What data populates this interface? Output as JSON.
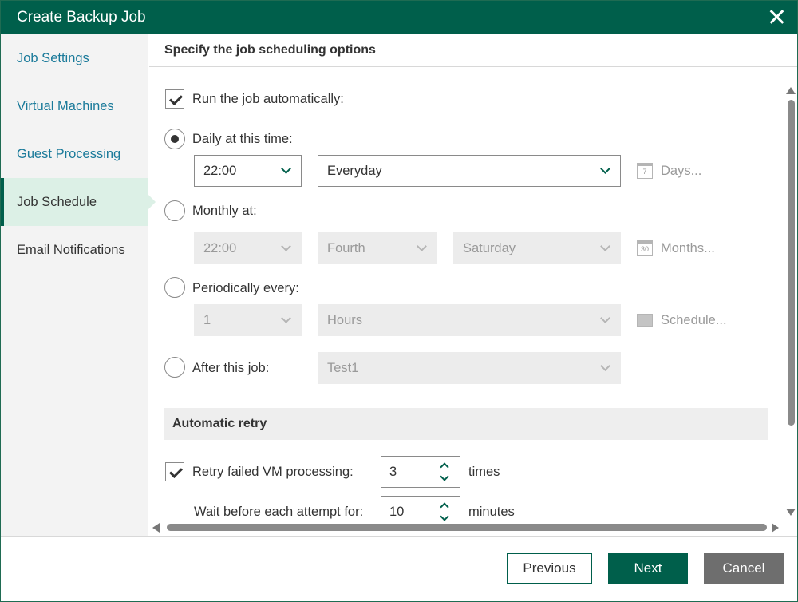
{
  "window": {
    "title": "Create Backup Job"
  },
  "sidebar": {
    "items": [
      {
        "label": "Job Settings"
      },
      {
        "label": "Virtual Machines"
      },
      {
        "label": "Guest Processing"
      },
      {
        "label": "Job Schedule"
      },
      {
        "label": "Email Notifications"
      }
    ],
    "active_index": 3
  },
  "header": {
    "title": "Specify the job scheduling options"
  },
  "schedule": {
    "run_auto": {
      "label": "Run the job automatically:",
      "checked": true
    },
    "daily": {
      "label": "Daily at this time:",
      "selected": true,
      "time": "22:00",
      "frequency": "Everyday",
      "link": "Days...",
      "link_icon": "calendar-7-icon",
      "icon_text": "7"
    },
    "monthly": {
      "label": "Monthly at:",
      "selected": false,
      "time": "22:00",
      "week": "Fourth",
      "day": "Saturday",
      "link": "Months...",
      "link_icon": "calendar-30-icon",
      "icon_text": "30"
    },
    "periodic": {
      "label": "Periodically every:",
      "selected": false,
      "value": "1",
      "unit": "Hours",
      "link": "Schedule...",
      "link_icon": "grid-icon"
    },
    "after": {
      "label": "After this job:",
      "selected": false,
      "job": "Test1"
    }
  },
  "retry": {
    "section_title": "Automatic retry",
    "retry_failed": {
      "label": "Retry failed VM processing:",
      "checked": true,
      "value": "3",
      "unit": "times"
    },
    "wait": {
      "label": "Wait before each attempt for:",
      "value": "10",
      "unit": "minutes"
    }
  },
  "footer": {
    "previous": "Previous",
    "next": "Next",
    "cancel": "Cancel"
  },
  "colors": {
    "accent": "#005f4b",
    "link": "#1a7a9a",
    "active_nav_bg": "#dcf0e6",
    "cancel_bg": "#6e6e6e"
  }
}
